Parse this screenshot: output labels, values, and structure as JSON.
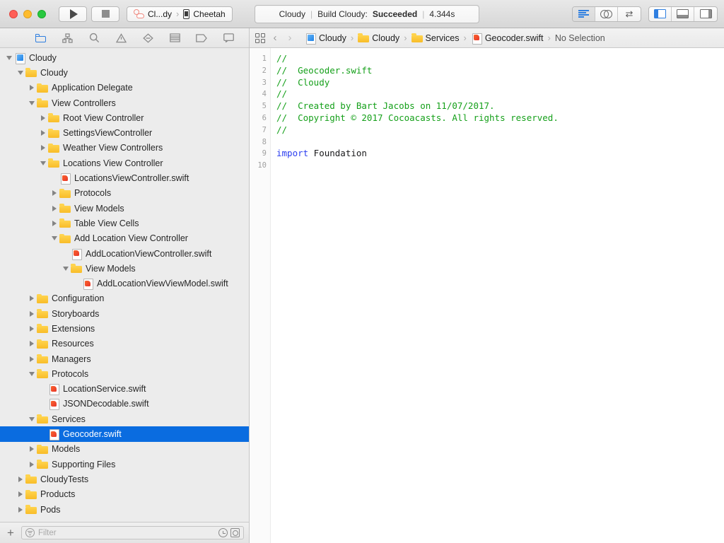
{
  "window": {
    "traffic_lights": [
      {
        "name": "close",
        "color": "#ff5f57"
      },
      {
        "name": "minimize",
        "color": "#febc2e"
      },
      {
        "name": "zoom",
        "color": "#28c840"
      }
    ]
  },
  "toolbar": {
    "run_label": "Run",
    "stop_label": "Stop",
    "scheme": {
      "app_name": "Cl...dy",
      "separator": "›",
      "destination": "Cheetah"
    },
    "status": {
      "project": "Cloudy",
      "divider": "|",
      "action": "Build Cloudy:",
      "result": "Succeeded",
      "duration": "4.344s"
    },
    "editor_modes": [
      {
        "name": "standard-editor",
        "icon": "lines-icon",
        "active": true
      },
      {
        "name": "assistant-editor",
        "icon": "venn-icon",
        "active": false
      },
      {
        "name": "version-editor",
        "icon": "arrows-icon",
        "active": false
      }
    ],
    "panel_toggles": [
      {
        "name": "navigator-toggle",
        "icon": "panel-left-icon",
        "active": true
      },
      {
        "name": "debug-toggle",
        "icon": "panel-bottom-icon",
        "active": false
      },
      {
        "name": "inspector-toggle",
        "icon": "panel-right-icon",
        "active": false
      }
    ]
  },
  "navigator": {
    "tabs": [
      {
        "name": "project-navigator",
        "icon": "folder-icon",
        "active": true
      },
      {
        "name": "source-control-navigator",
        "icon": "branch-icon",
        "active": false
      },
      {
        "name": "find-navigator",
        "icon": "search-icon",
        "active": false
      },
      {
        "name": "issue-navigator",
        "icon": "warning-triangle-icon",
        "active": false
      },
      {
        "name": "test-navigator",
        "icon": "diamond-icon",
        "active": false
      },
      {
        "name": "debug-navigator",
        "icon": "gauge-icon",
        "active": false
      },
      {
        "name": "breakpoint-navigator",
        "icon": "tag-icon",
        "active": false
      },
      {
        "name": "report-navigator",
        "icon": "message-icon",
        "active": false
      }
    ],
    "tree": [
      {
        "label": "Cloudy",
        "depth": 0,
        "icon": "proj",
        "disclosure": "down"
      },
      {
        "label": "Cloudy",
        "depth": 1,
        "icon": "folder",
        "disclosure": "down"
      },
      {
        "label": "Application Delegate",
        "depth": 2,
        "icon": "folder",
        "disclosure": "right"
      },
      {
        "label": "View Controllers",
        "depth": 2,
        "icon": "folder",
        "disclosure": "down"
      },
      {
        "label": "Root View Controller",
        "depth": 3,
        "icon": "folder",
        "disclosure": "right"
      },
      {
        "label": "SettingsViewController",
        "depth": 3,
        "icon": "folder",
        "disclosure": "right"
      },
      {
        "label": "Weather View Controllers",
        "depth": 3,
        "icon": "folder",
        "disclosure": "right"
      },
      {
        "label": "Locations View Controller",
        "depth": 3,
        "icon": "folder",
        "disclosure": "down"
      },
      {
        "label": "LocationsViewController.swift",
        "depth": 4,
        "icon": "swift",
        "disclosure": "none"
      },
      {
        "label": "Protocols",
        "depth": 4,
        "icon": "folder",
        "disclosure": "right"
      },
      {
        "label": "View Models",
        "depth": 4,
        "icon": "folder",
        "disclosure": "right"
      },
      {
        "label": "Table View Cells",
        "depth": 4,
        "icon": "folder",
        "disclosure": "right"
      },
      {
        "label": "Add Location View Controller",
        "depth": 4,
        "icon": "folder",
        "disclosure": "down"
      },
      {
        "label": "AddLocationViewController.swift",
        "depth": 5,
        "icon": "swift",
        "disclosure": "none"
      },
      {
        "label": "View Models",
        "depth": 5,
        "icon": "folder",
        "disclosure": "down"
      },
      {
        "label": "AddLocationViewViewModel.swift",
        "depth": 6,
        "icon": "swift",
        "disclosure": "none"
      },
      {
        "label": "Configuration",
        "depth": 2,
        "icon": "folder",
        "disclosure": "right"
      },
      {
        "label": "Storyboards",
        "depth": 2,
        "icon": "folder",
        "disclosure": "right"
      },
      {
        "label": "Extensions",
        "depth": 2,
        "icon": "folder",
        "disclosure": "right"
      },
      {
        "label": "Resources",
        "depth": 2,
        "icon": "folder",
        "disclosure": "right"
      },
      {
        "label": "Managers",
        "depth": 2,
        "icon": "folder",
        "disclosure": "right"
      },
      {
        "label": "Protocols",
        "depth": 2,
        "icon": "folder",
        "disclosure": "down"
      },
      {
        "label": "LocationService.swift",
        "depth": 3,
        "icon": "swift",
        "disclosure": "none"
      },
      {
        "label": "JSONDecodable.swift",
        "depth": 3,
        "icon": "swift",
        "disclosure": "none"
      },
      {
        "label": "Services",
        "depth": 2,
        "icon": "folder",
        "disclosure": "down"
      },
      {
        "label": "Geocoder.swift",
        "depth": 3,
        "icon": "swift",
        "disclosure": "none",
        "selected": true
      },
      {
        "label": "Models",
        "depth": 2,
        "icon": "folder",
        "disclosure": "right"
      },
      {
        "label": "Supporting Files",
        "depth": 2,
        "icon": "folder",
        "disclosure": "right"
      },
      {
        "label": "CloudyTests",
        "depth": 1,
        "icon": "folder",
        "disclosure": "right"
      },
      {
        "label": "Products",
        "depth": 1,
        "icon": "folder",
        "disclosure": "right"
      },
      {
        "label": "Pods",
        "depth": 1,
        "icon": "folder",
        "disclosure": "right"
      }
    ],
    "filter": {
      "add_label": "+",
      "placeholder": "Filter",
      "value": "",
      "recent_icon": "clock-icon",
      "focus_icon": "focus-box-icon"
    },
    "selection_color": "#0a6ce0"
  },
  "editor": {
    "jump_bar": {
      "related_items_icon": "grid-icon",
      "back_label": "‹",
      "forward_label": "›",
      "breadcrumbs": [
        {
          "label": "Cloudy",
          "icon": "proj"
        },
        {
          "label": "Cloudy",
          "icon": "folder"
        },
        {
          "label": "Services",
          "icon": "folder"
        },
        {
          "label": "Geocoder.swift",
          "icon": "swift"
        },
        {
          "label": "No Selection",
          "icon": "none"
        }
      ],
      "separator": "›"
    },
    "line_numbers": [
      "1",
      "2",
      "3",
      "4",
      "5",
      "6",
      "7",
      "8",
      "9",
      "10"
    ],
    "code_lines": [
      {
        "n": 1,
        "tokens": [
          {
            "t": "//",
            "c": "cmt"
          }
        ]
      },
      {
        "n": 2,
        "tokens": [
          {
            "t": "//  Geocoder.swift",
            "c": "cmt"
          }
        ]
      },
      {
        "n": 3,
        "tokens": [
          {
            "t": "//  Cloudy",
            "c": "cmt"
          }
        ]
      },
      {
        "n": 4,
        "tokens": [
          {
            "t": "//",
            "c": "cmt"
          }
        ]
      },
      {
        "n": 5,
        "tokens": [
          {
            "t": "//  Created by Bart Jacobs on 11/07/2017.",
            "c": "cmt"
          }
        ]
      },
      {
        "n": 6,
        "tokens": [
          {
            "t": "//  Copyright © 2017 Cocoacasts. All rights reserved.",
            "c": "cmt"
          }
        ]
      },
      {
        "n": 7,
        "tokens": [
          {
            "t": "//",
            "c": "cmt"
          }
        ]
      },
      {
        "n": 8,
        "tokens": [
          {
            "t": "",
            "c": "plain"
          }
        ]
      },
      {
        "n": 9,
        "tokens": [
          {
            "t": "import",
            "c": "kw"
          },
          {
            "t": " Foundation",
            "c": "plain"
          }
        ]
      },
      {
        "n": 10,
        "tokens": [
          {
            "t": "",
            "c": "plain"
          }
        ]
      }
    ],
    "colors": {
      "comment": "#15a01a",
      "keyword": "#2b3ef0",
      "plain": "#18181a",
      "background": "#ffffff"
    }
  }
}
